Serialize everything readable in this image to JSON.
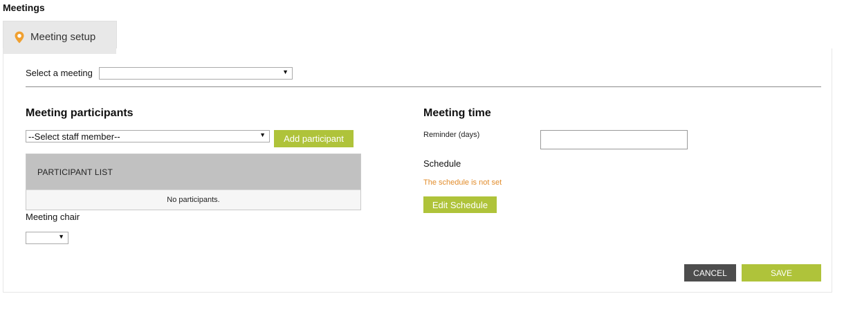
{
  "header": {
    "title": "Meetings"
  },
  "tabs": [
    {
      "label": "Meeting setup",
      "icon": "location-pin-icon",
      "active": true
    }
  ],
  "colors": {
    "accent_green": "#afc33a",
    "tab_icon_orange": "#f0a030",
    "status_orange": "#e28c2b",
    "cancel_dark": "#4d4d4d"
  },
  "meeting_select": {
    "label": "Select a meeting",
    "value": ""
  },
  "participants": {
    "heading": "Meeting participants",
    "staff_select_value": "--Select staff member--",
    "add_button": "Add participant",
    "list_header": "PARTICIPANT LIST",
    "empty_text": "No participants.",
    "chair_label": "Meeting chair",
    "chair_value": ""
  },
  "meeting_time": {
    "heading": "Meeting time",
    "reminder_label": "Reminder (days)",
    "reminder_value": "",
    "schedule_label": "Schedule",
    "schedule_status": "The schedule is not set",
    "edit_button": "Edit Schedule"
  },
  "actions": {
    "cancel": "CANCEL",
    "save": "SAVE"
  }
}
